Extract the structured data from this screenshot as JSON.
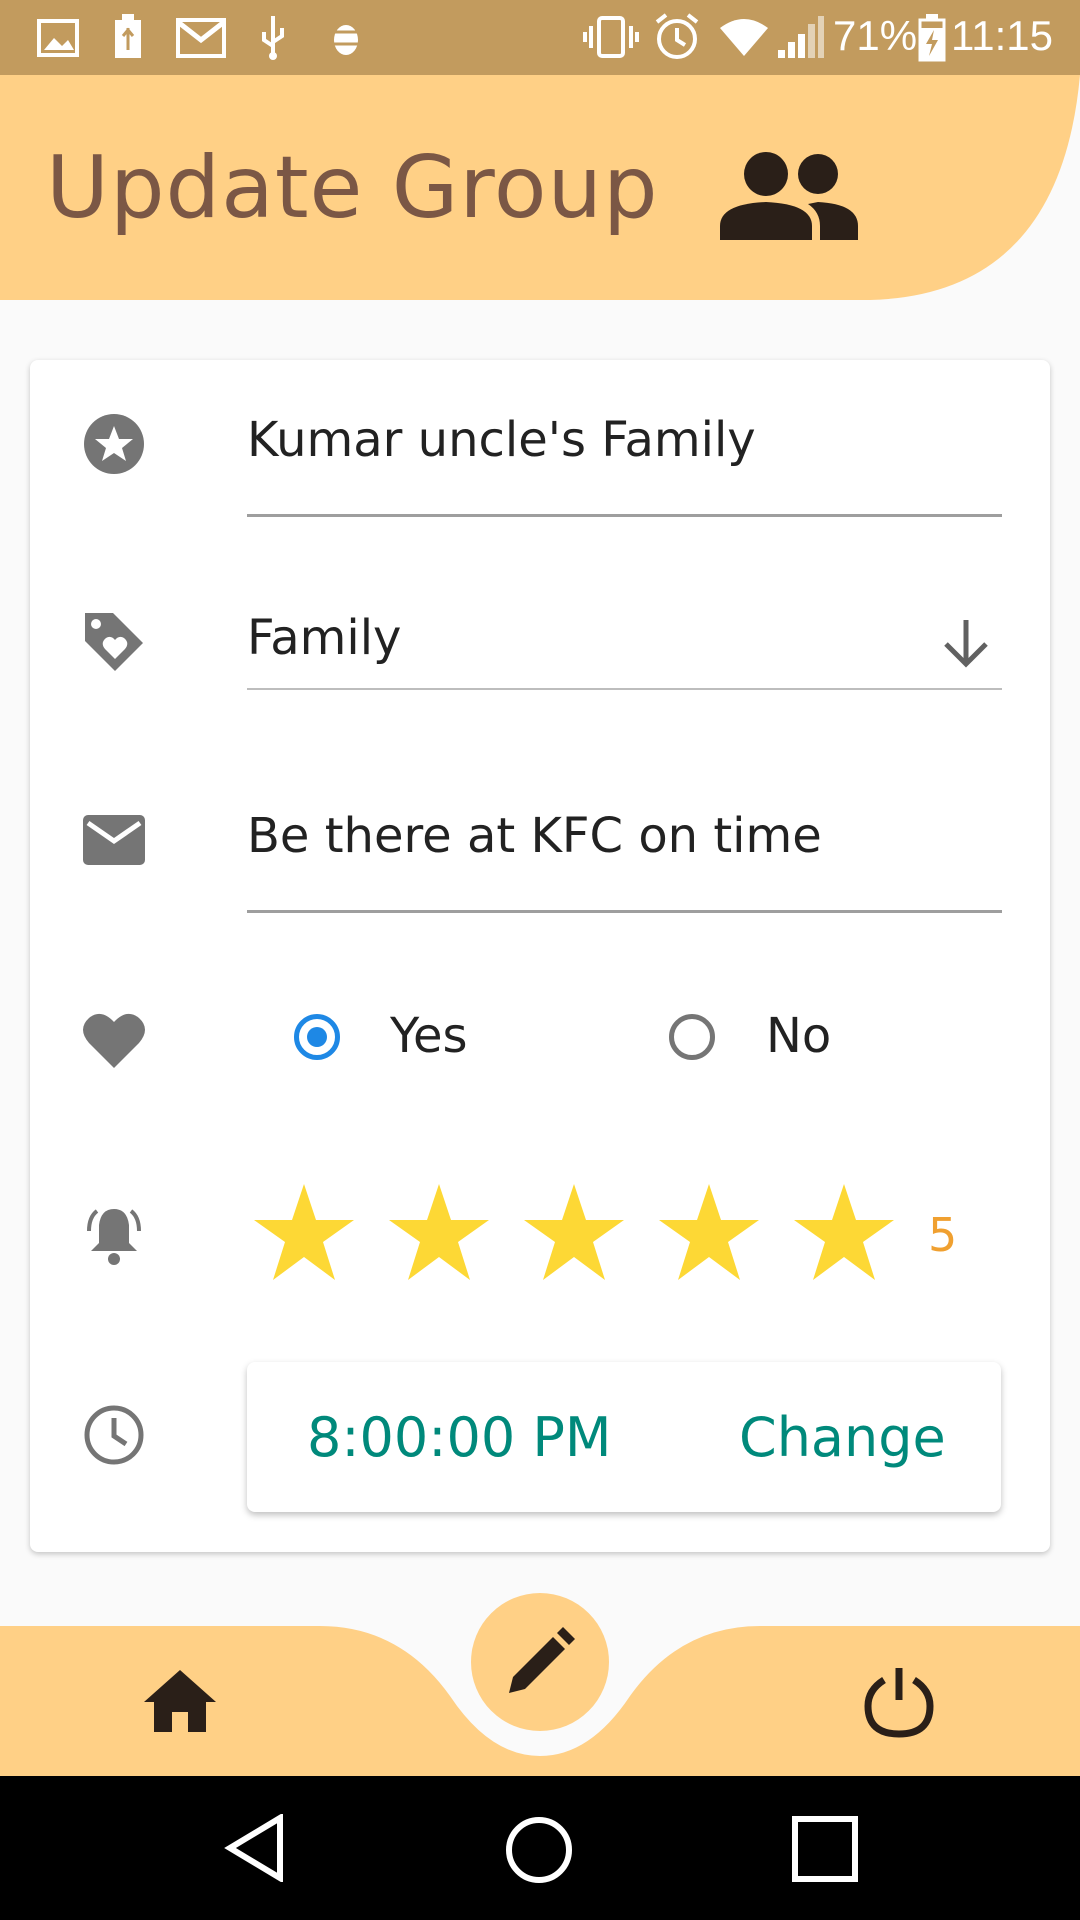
{
  "status_bar": {
    "battery_percent": "71%",
    "time": "11:15",
    "icons": [
      "image-icon",
      "battery-usb-icon",
      "gmail-icon",
      "usb-icon",
      "android-debug-icon",
      "vibrate-icon",
      "alarm-icon",
      "wifi-icon",
      "signal-icon",
      "battery-charging-icon"
    ]
  },
  "header": {
    "title": "Update Group",
    "icon": "group-icon"
  },
  "form": {
    "name": {
      "icon": "star-circle-icon",
      "value": "Kumar uncle's Family"
    },
    "category": {
      "icon": "tag-heart-icon",
      "value": "Family",
      "dropdown_icon": "arrow-down-icon"
    },
    "message": {
      "icon": "mail-icon",
      "value": "Be there at KFC on time"
    },
    "favorite": {
      "icon": "heart-icon",
      "options": [
        {
          "label": "Yes",
          "selected": true
        },
        {
          "label": "No",
          "selected": false
        }
      ]
    },
    "priority": {
      "icon": "bell-icon",
      "rating": 5,
      "max": 5,
      "rating_label": "5"
    },
    "time": {
      "icon": "clock-icon",
      "value": "8:00:00 PM",
      "change_label": "Change"
    }
  },
  "bottom_nav": {
    "items": [
      "home-icon",
      "edit-icon",
      "power-icon"
    ]
  },
  "system_nav": [
    "back-icon",
    "home-circle-icon",
    "recents-icon"
  ],
  "colors": {
    "accent": "#ffd086",
    "status_bar": "#c29b5e",
    "title": "#7b5745",
    "teal": "#00897b",
    "radio_selected": "#1e88e5",
    "star": "#fdd835"
  }
}
